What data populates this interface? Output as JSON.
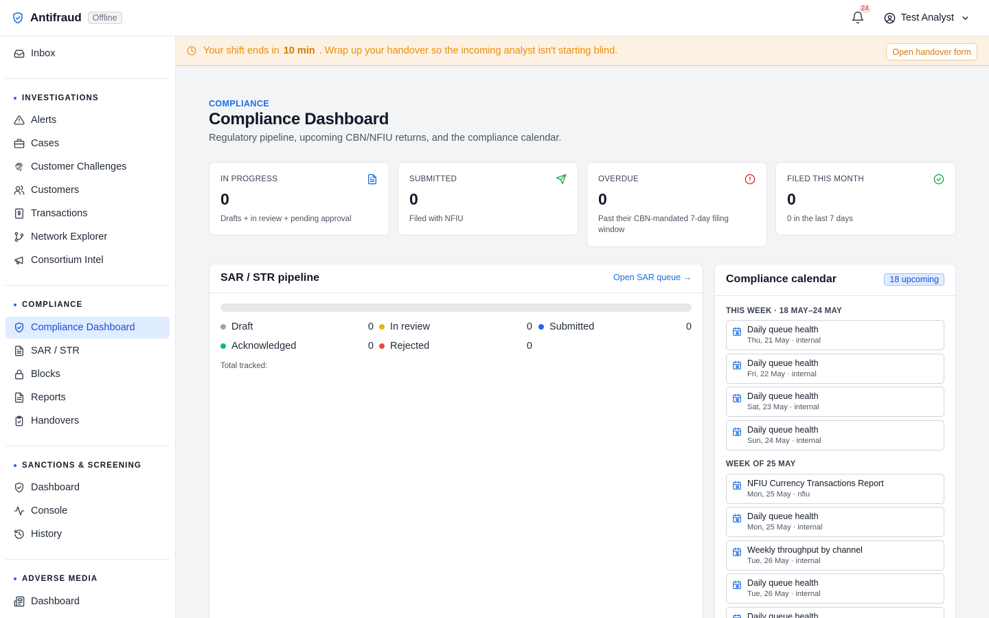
{
  "app": {
    "name": "Antifraud",
    "status": "Offline"
  },
  "header": {
    "notification_count": "24",
    "user_name": "Test Analyst"
  },
  "sidebar": {
    "inbox": "Inbox",
    "sections": {
      "investigations": "INVESTIGATIONS",
      "compliance": "COMPLIANCE",
      "sanctions": "SANCTIONS & SCREENING",
      "adverse": "ADVERSE MEDIA"
    },
    "investigations": [
      "Alerts",
      "Cases",
      "Customer Challenges",
      "Customers",
      "Transactions",
      "Network Explorer",
      "Consortium Intel"
    ],
    "compliance": [
      "Compliance Dashboard",
      "SAR / STR",
      "Blocks",
      "Reports",
      "Handovers"
    ],
    "sanctions": [
      "Dashboard",
      "Console",
      "History"
    ],
    "adverse": [
      "Dashboard"
    ]
  },
  "banner": {
    "prefix": "Your shift ends in",
    "time": "10 min",
    "suffix": ". Wrap up your handover so the incoming analyst isn't starting blind.",
    "button": "Open handover form"
  },
  "page": {
    "eyebrow": "COMPLIANCE",
    "title": "Compliance Dashboard",
    "subtitle": "Regulatory pipeline, upcoming CBN/NFIU returns, and the compliance calendar."
  },
  "stats": [
    {
      "label": "IN PROGRESS",
      "value": "0",
      "note": "Drafts + in review + pending approval",
      "icon": "document-icon",
      "color": "#1d6fe0"
    },
    {
      "label": "SUBMITTED",
      "value": "0",
      "note": "Filed with NFIU",
      "icon": "send-icon",
      "color": "#16a34a"
    },
    {
      "label": "OVERDUE",
      "value": "0",
      "note": "Past their CBN-mandated 7-day filing window",
      "icon": "alert-circle-icon",
      "color": "#dc2626"
    },
    {
      "label": "FILED THIS MONTH",
      "value": "0",
      "note": "0 in the last 7 days",
      "icon": "check-circle-icon",
      "color": "#16a34a"
    }
  ],
  "pipeline": {
    "title": "SAR / STR pipeline",
    "link": "Open SAR queue →",
    "legend": [
      {
        "label": "Draft",
        "value": "0",
        "color": "#9ca3af"
      },
      {
        "label": "In review",
        "value": "0",
        "color": "#eab308"
      },
      {
        "label": "Submitted",
        "value": "0",
        "color": "#2563eb"
      },
      {
        "label": "Acknowledged",
        "value": "0",
        "color": "#10b981"
      },
      {
        "label": "Rejected",
        "value": "0",
        "color": "#ef4444"
      }
    ],
    "total_label": "Total tracked:"
  },
  "calendar": {
    "title": "Compliance calendar",
    "badge": "18 upcoming",
    "week1_label": "THIS WEEK · 18 MAY–24 MAY",
    "week2_label": "WEEK OF 25 MAY",
    "week1": [
      {
        "title": "Daily queue health",
        "date": "Thu, 21 May · internal"
      },
      {
        "title": "Daily queue health",
        "date": "Fri, 22 May · internal"
      },
      {
        "title": "Daily queue health",
        "date": "Sat, 23 May · internal"
      },
      {
        "title": "Daily queue health",
        "date": "Sun, 24 May · internal"
      }
    ],
    "week2": [
      {
        "title": "NFIU Currency Transactions Report",
        "date": "Mon, 25 May · nfiu"
      },
      {
        "title": "Daily queue health",
        "date": "Mon, 25 May · internal"
      },
      {
        "title": "Weekly throughput by channel",
        "date": "Tue, 26 May · internal"
      },
      {
        "title": "Daily queue health",
        "date": "Tue, 26 May · internal"
      },
      {
        "title": "Daily queue health",
        "date": ""
      }
    ]
  }
}
